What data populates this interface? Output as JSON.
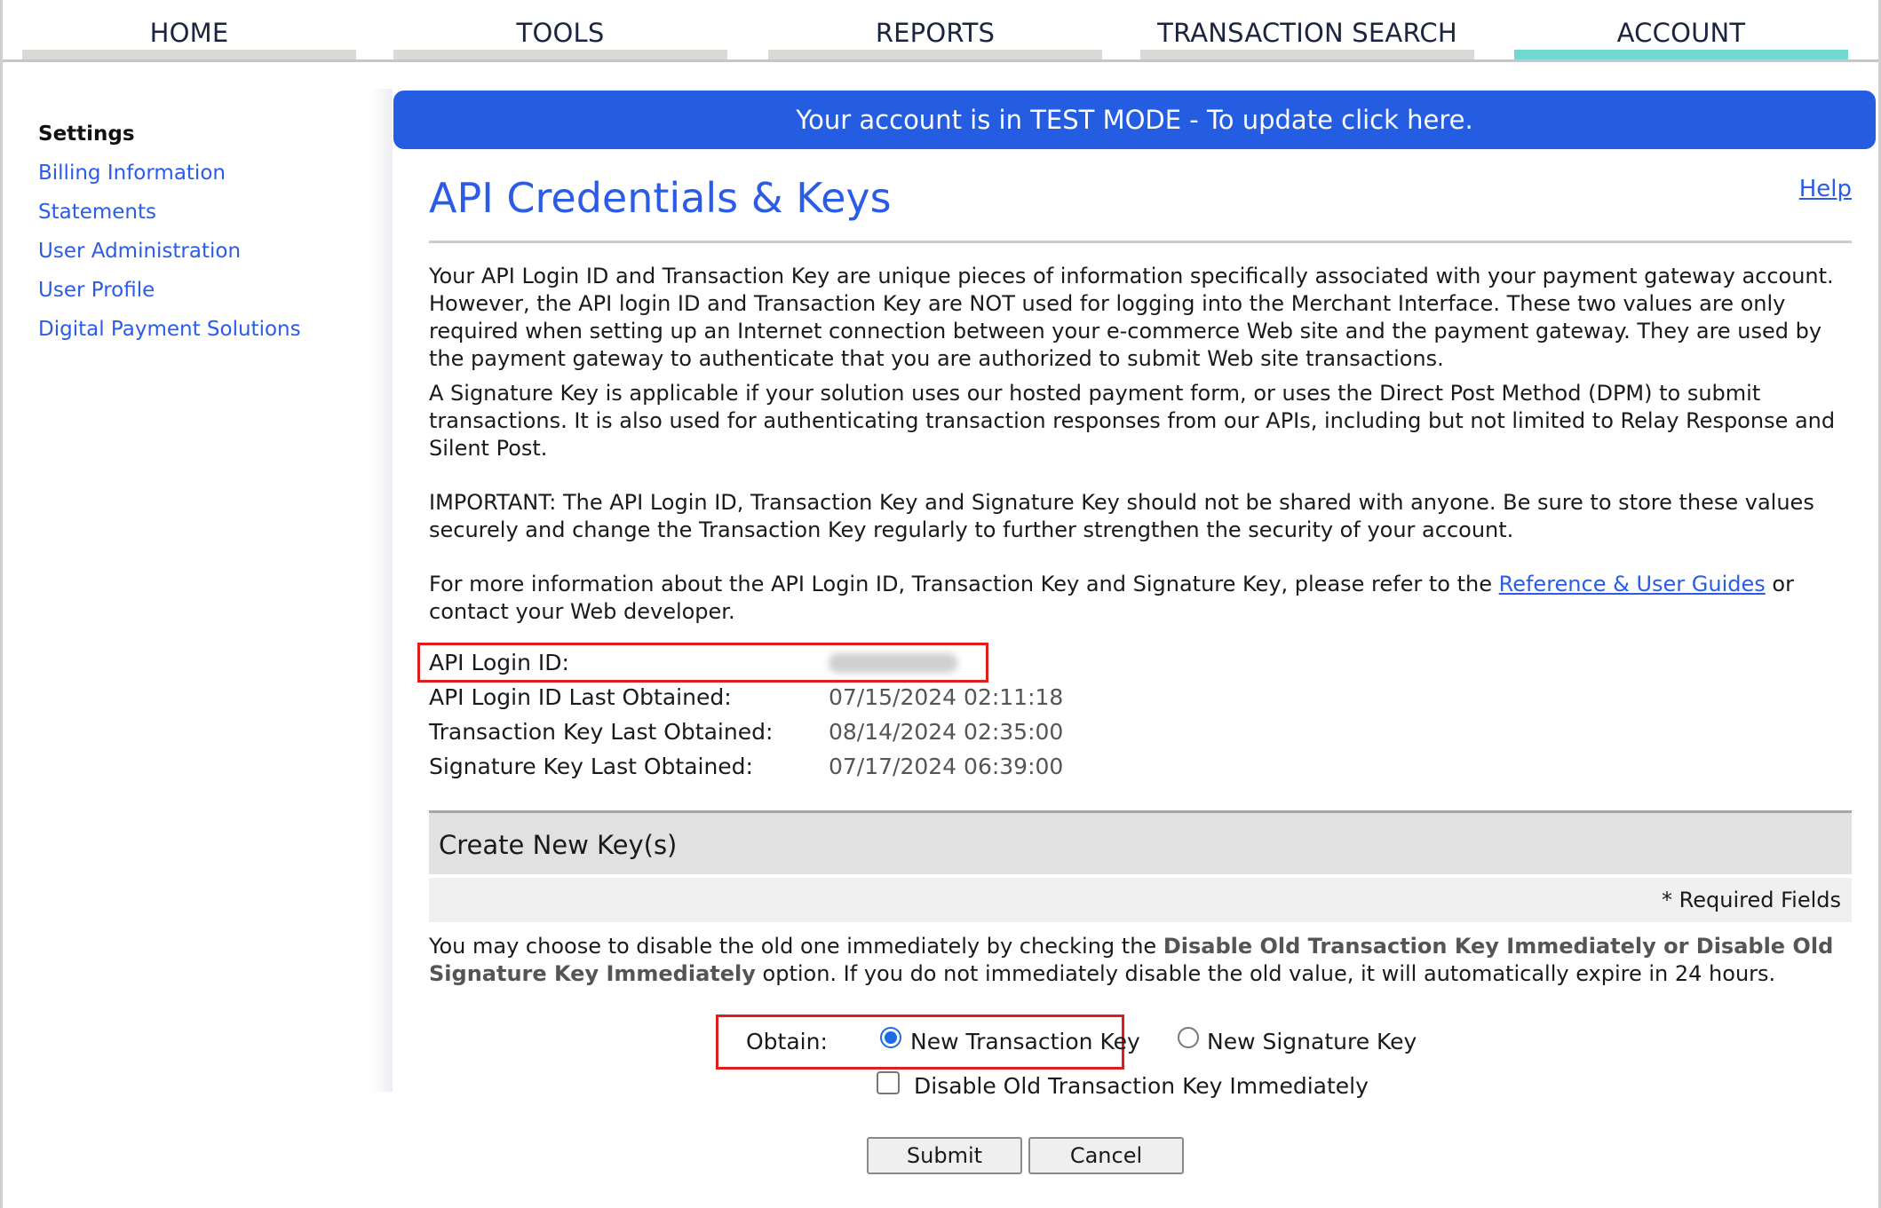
{
  "nav": {
    "tabs": [
      {
        "label": "HOME",
        "active": false
      },
      {
        "label": "TOOLS",
        "active": false
      },
      {
        "label": "REPORTS",
        "active": false
      },
      {
        "label": "TRANSACTION SEARCH",
        "active": false
      },
      {
        "label": "ACCOUNT",
        "active": true
      }
    ]
  },
  "sidebar": {
    "heading": "Settings",
    "items": [
      {
        "label": "Billing Information"
      },
      {
        "label": "Statements"
      },
      {
        "label": "User Administration"
      },
      {
        "label": "User Profile"
      },
      {
        "label": "Digital Payment Solutions"
      }
    ]
  },
  "banner": {
    "text": "Your account is in TEST MODE - To update click here."
  },
  "page": {
    "title": "API Credentials & Keys",
    "help_label": "Help",
    "para1": "Your API Login ID and Transaction Key are unique pieces of information specifically associated with your payment gateway account. However, the API login ID and Transaction Key are NOT used for logging into the Merchant Interface. These two values are only required when setting up an Internet connection between your e-commerce Web site and the payment gateway. They are used by the payment gateway to authenticate that you are authorized to submit Web site transactions.",
    "para2": "A Signature Key is applicable if your solution uses our hosted payment form, or uses the Direct Post Method (DPM) to submit transactions. It is also used for authenticating transaction responses from our APIs, including but not limited to Relay Response and Silent Post.",
    "para3": "IMPORTANT: The API Login ID, Transaction Key and Signature Key should not be shared with anyone. Be sure to store these values securely and change the Transaction Key regularly to further strengthen the security of your account.",
    "para4_before": "For more information about the API Login ID, Transaction Key and Signature Key, please refer to the ",
    "para4_link": "Reference & User Guides",
    "para4_after": " or contact your Web developer."
  },
  "credentials": [
    {
      "label": "API Login ID:",
      "value": ""
    },
    {
      "label": "API Login ID Last Obtained:",
      "value": "07/15/2024 02:11:18"
    },
    {
      "label": "Transaction Key Last Obtained:",
      "value": "08/14/2024 02:35:00"
    },
    {
      "label": "Signature Key Last Obtained:",
      "value": "07/17/2024 06:39:00"
    }
  ],
  "create": {
    "heading": "Create New Key(s)",
    "required_note": "* Required Fields",
    "info_before": "You may choose to disable the old one immediately by checking the ",
    "info_emphasis": "Disable Old Transaction Key Immediately or Disable Old Signature Key Immediately",
    "info_after": " option. If you do not immediately disable the old value, it will automatically expire in 24 hours.",
    "obtain_label": "Obtain:",
    "option_transaction": "New Transaction Key",
    "option_signature": "New Signature Key",
    "selected_option": "New Transaction Key",
    "disable_checkbox_label": "Disable Old Transaction Key Immediately",
    "disable_checked": false,
    "submit_label": "Submit",
    "cancel_label": "Cancel"
  },
  "colors": {
    "accent_blue": "#245ce2",
    "link_blue": "#2a5ce8",
    "active_tab": "#72d9d2",
    "highlight_red": "#e21b1b"
  }
}
